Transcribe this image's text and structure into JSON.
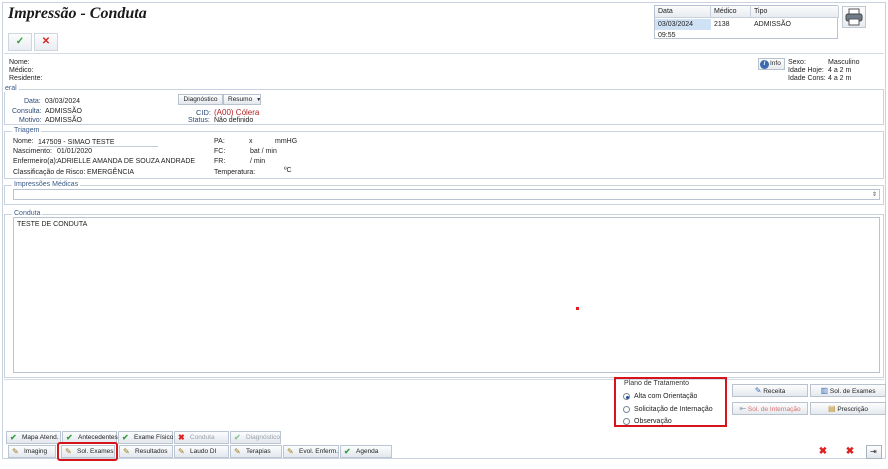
{
  "window": {
    "title": "Impressão - Conduta"
  },
  "toolbar": {
    "confirm_icon": "✓",
    "cancel_icon": "✕"
  },
  "header_table": {
    "columns": [
      "Data",
      "Médico",
      "Tipo"
    ],
    "row": [
      "03/03/2024 09:55",
      "2138",
      "ADMISSÃO"
    ]
  },
  "patient": {
    "nome_label": "Nome:",
    "medico_label": "Médico:",
    "residente_label": "Residente:",
    "info_label": "Info",
    "sexo_label": "Sexo:",
    "sexo_value": "Masculino",
    "idade_hoje_label": "Idade Hoje:",
    "idade_hoje_value": "4 a 2 m",
    "idade_cons_label": "Idade Cons:",
    "idade_cons_value": "4 a 2 m"
  },
  "geral": {
    "title": "eral",
    "data_label": "Data:",
    "data_value": "03/03/2024",
    "consulta_label": "Consulta:",
    "consulta_value": "ADMISSÃO",
    "motivo_label": "Motivo:",
    "motivo_value": "ADMISSÃO",
    "diagnostico_btn": "Diagnóstico",
    "resumo_btn": "Resumo",
    "cid_label": "CID:",
    "cid_value": "(A00) Cólera",
    "status_label": "Status:",
    "status_value": "Não definido"
  },
  "triagem": {
    "title": "Triagem",
    "nome_label": "Nome:",
    "nome_value": "147509 - SIMAO TESTE",
    "nascimento_label": "Nascimento:",
    "nascimento_value": "01/01/2020",
    "enfermeiro_label": "Enfermeiro(a):",
    "enfermeiro_value": "ADRIELLE AMANDA DE SOUZA ANDRADE",
    "risco_label": "Classificação de Risco:",
    "risco_value": "EMERGÊNCIA",
    "pa_label": "PA:",
    "pa_x": "x",
    "pa_unit": "mmHG",
    "fc_label": "FC:",
    "fc_unit": "bat / min",
    "fr_label": "FR:",
    "fr_unit": "/ min",
    "temp_label": "Temperatura:",
    "temp_unit": "ºC"
  },
  "impressoes": {
    "title": "Impressões Médicas"
  },
  "conduta": {
    "title": "Conduta",
    "text": "TESTE DE CONDUTA"
  },
  "plano": {
    "title": "Plano de Tratamento",
    "options": [
      "Alta com Orientação",
      "Solicitação de Internação",
      "Observação"
    ],
    "selected": "Alta com Orientação"
  },
  "right_buttons": {
    "receita": "Receita",
    "sol_exames": "Sol. de Exames",
    "sol_internacao": "Sol. de Internação",
    "prescricao": "Prescrição"
  },
  "tabs_row1": [
    "Mapa Atend.",
    "Antecedentes",
    "Exame Físico",
    "Conduta",
    "Diagnóstico"
  ],
  "tabs_row2": [
    "Imaging",
    "Sol. Exames",
    "Resultados",
    "Laudo DI",
    "Terapias",
    "Evol. Enferm.",
    "Agenda"
  ],
  "colors": {
    "accent": "#2c4a7a",
    "highlight": "#d6141b",
    "cid": "#b22222"
  }
}
